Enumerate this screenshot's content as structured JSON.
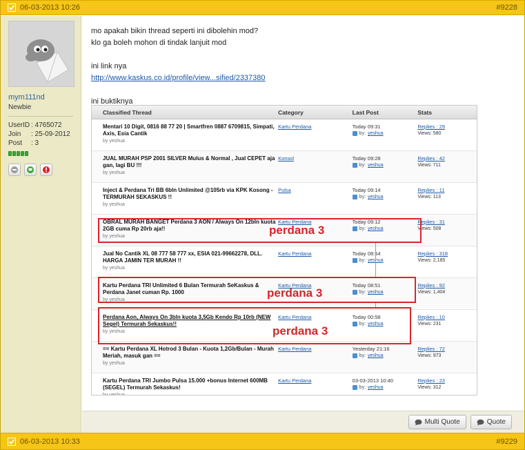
{
  "post_top": {
    "date": "06-03-2013 10:26",
    "number": "#9228"
  },
  "post_bottom": {
    "date": "06-03-2013 10:33",
    "number": "#9229"
  },
  "user": {
    "username": "mym111nd",
    "rank": "Newbie",
    "userid_label": "UserID",
    "userid": ": 4765072",
    "join_label": "Join",
    "join": ": 25-09-2012",
    "post_label": "Post",
    "post": ": 3"
  },
  "message": {
    "line1": "mo apakah bikin thread seperti ini dibolehin mod?",
    "line2": "klo ga boleh mohon di tindak lanjuit mod",
    "line3": "ini link nya",
    "link": "http://www.kaskus.co.id/profile/view...sified/2337380",
    "line4": "ini buktiknya"
  },
  "screenshot": {
    "headers": [
      "Classified Thread",
      "Category",
      "Last Post",
      "Stats"
    ],
    "rows": [
      {
        "title": "Mentari 10 Digit, 0816 88 77 20 | Smartfren 0887 6709815, Simpati, Axis, Esia Cantik",
        "by": "by yeshua",
        "category": "Kartu Perdana",
        "time": "Today 09:31",
        "last_by": "by:",
        "last_user": "yeshua",
        "replies": "Replies : 29",
        "views": "Views: 580"
      },
      {
        "title": "JUAL MURAH PSP 2001 SILVER Mulus & Normal , Jual CEPET aja gan, lagi BU !!!",
        "by": "by yeshua",
        "category": "Konsol",
        "time": "Today 09:28",
        "last_by": "by:",
        "last_user": "yeshua",
        "replies": "Replies : 42",
        "views": "Views: 711"
      },
      {
        "title": "Inject & Perdana Tri BB 6bln Unlimited @105rb via KPK Kosong - TERMURAH SEKASKUS !!",
        "by": "by yeshua",
        "category": "Pulsa",
        "time": "Today 09:14",
        "last_by": "by:",
        "last_user": "yeshua",
        "replies": "Replies : 11",
        "views": "Views: 113"
      },
      {
        "title": "OBRAL MURAH BANGET Perdana 3 AON / Always On 12bln kuota 2GB cuma Rp 20rb aja!!",
        "by": "by yeshua",
        "category": "Kartu Perdana",
        "time": "Today 09:12",
        "last_by": "by:",
        "last_user": "yeshua",
        "replies": "Replies : 31",
        "views": "Views: 508"
      },
      {
        "title": "Jual No Cantik XL 08 777 58 777 xx, ESIA 021-99662278, DLL. HARGA JAMIN TER MURAH !!",
        "by": "by yeshua",
        "category": "Kartu Perdana",
        "time": "Today 08:54",
        "last_by": "by:",
        "last_user": "yeshua",
        "replies": "Replies : 318",
        "views": "Views: 2,185"
      },
      {
        "title": "Kartu Perdana TRI Unlimited 6 Bulan Termurah SeKaskus & Perdana Janet cuman Rp. 1000",
        "by": "by yeshua",
        "category": "Kartu Perdana",
        "time": "Today 08:51",
        "last_by": "by:",
        "last_user": "yeshua",
        "replies": "Replies : 92",
        "views": "Views: 1,404"
      },
      {
        "title": "Perdana Aon, Always On 3bln kuota 3,5Gb Kendo Rp 10rb (NEW Segel) Termurah Sekaskus!!",
        "by": "by yeshua",
        "category": "Kartu Perdana",
        "time": "Today 00:58",
        "last_by": "by:",
        "last_user": "yeshua",
        "replies": "Replies : 10",
        "views": "Views: 231"
      },
      {
        "title": "== Kartu Perdana XL Hotrod 3 Bulan - Kuota 1,2Gb/Bulan - Murah Meriah, masuk gan ==",
        "by": "by yeshua",
        "category": "Kartu Perdana",
        "time": "Yesterday 21:16",
        "last_by": "by:",
        "last_user": "yeshua",
        "replies": "Replies : 72",
        "views": "Views: 973"
      },
      {
        "title": "Kartu Perdana TRI Jumbo Pulsa 15.000 +bonus Internet 600MB (SEGEL) Termurah Sekaskus!",
        "by": "by yeshua",
        "category": "Kartu Perdana",
        "time": "03-03-2013 10:40",
        "last_by": "by:",
        "last_user": "yeshua",
        "replies": "Replies : 23",
        "views": "Views: 312"
      }
    ],
    "annotation": "perdana 3"
  },
  "actions": {
    "multi_quote": "Multi Quote",
    "quote": "Quote"
  },
  "colors": {
    "header_bg": "#f5c518",
    "sidebar_bg": "#ebe9c6",
    "highlight": "#d9232a",
    "link": "#1b57a6"
  }
}
